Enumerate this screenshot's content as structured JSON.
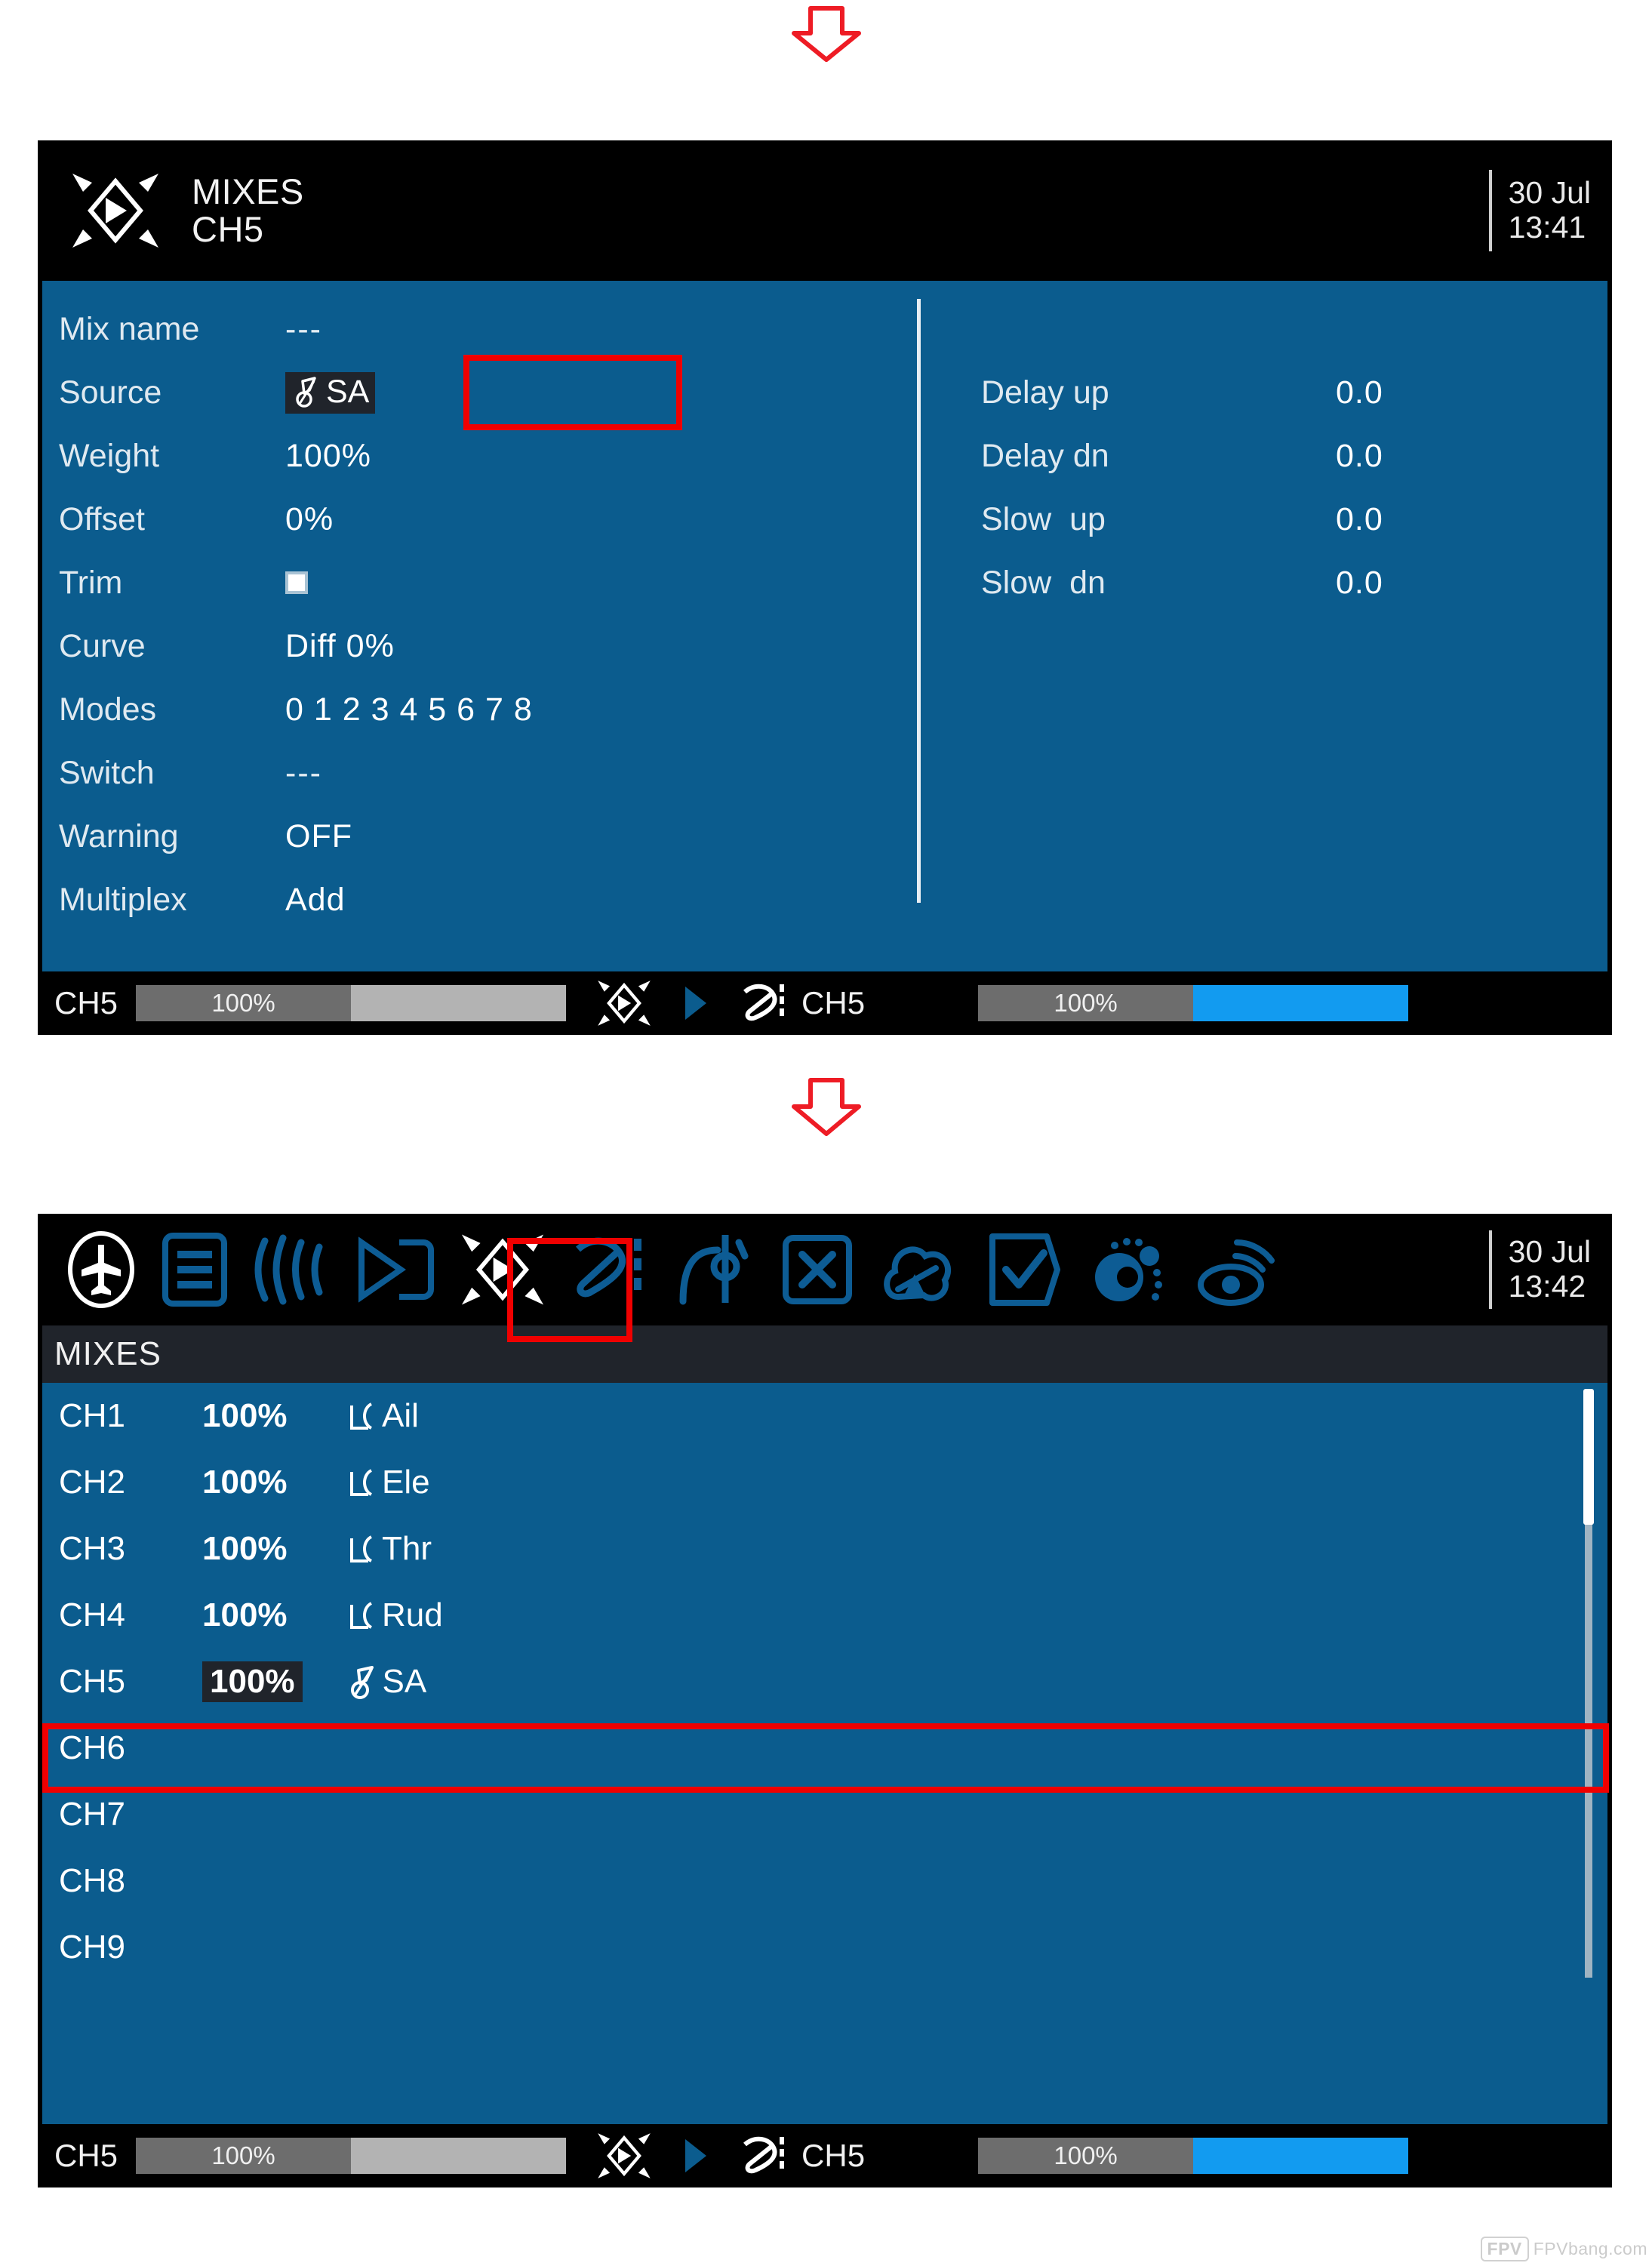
{
  "annotation": {
    "arrow_color": "#ee1c25",
    "watermark": "FPVbang.com",
    "watermark_badge": "FPV"
  },
  "mix_detail_screen": {
    "header": {
      "icon": "mixes-icon",
      "title": "MIXES",
      "subtitle": "CH5",
      "date": "30 Jul",
      "time": "13:41"
    },
    "left_fields": [
      {
        "label": "Mix name",
        "value": "---",
        "type": "dashes"
      },
      {
        "label": "Source",
        "value": "SA",
        "type": "switch-highlight"
      },
      {
        "label": "Weight",
        "value": "100%",
        "type": "text"
      },
      {
        "label": "Offset",
        "value": "0%",
        "type": "text"
      },
      {
        "label": "Trim",
        "value": "",
        "type": "checkbox"
      },
      {
        "label": "Curve",
        "value": "Diff  0%",
        "type": "text"
      },
      {
        "label": "Modes",
        "value": "0 1 2 3 4 5 6 7 8",
        "type": "text"
      },
      {
        "label": "Switch",
        "value": "---",
        "type": "dashes"
      },
      {
        "label": "Warning",
        "value": "OFF",
        "type": "text"
      },
      {
        "label": "Multiplex",
        "value": "Add",
        "type": "text"
      }
    ],
    "right_fields": [
      {
        "label": "Delay up",
        "value": "0.0"
      },
      {
        "label": "Delay dn",
        "value": "0.0"
      },
      {
        "label": "Slow  up",
        "value": "0.0"
      },
      {
        "label": "Slow  dn",
        "value": "0.0"
      }
    ],
    "status_bar": {
      "left_channel": "CH5",
      "left_percent": "100%",
      "left_fill_ratio": 0.5,
      "right_channel": "CH5",
      "right_percent": "100%",
      "right_fill_ratio": 0.5
    }
  },
  "mix_list_screen": {
    "header": {
      "date": "30 Jul",
      "time": "13:42",
      "icons": [
        "model-select-icon",
        "model-setup-icon",
        "heli-setup-icon",
        "flight-modes-icon",
        "mixes-icon",
        "outputs-icon",
        "curves-icon",
        "logical-switches-icon",
        "special-functions-icon",
        "custom-scripts-icon",
        "telemetry-icon",
        "display-icon"
      ]
    },
    "section_title": "MIXES",
    "rows": [
      {
        "channel": "CH1",
        "percent": "100%",
        "source": "Ail",
        "source_icon": "stick-icon",
        "selected": false
      },
      {
        "channel": "CH2",
        "percent": "100%",
        "source": "Ele",
        "source_icon": "stick-icon",
        "selected": false
      },
      {
        "channel": "CH3",
        "percent": "100%",
        "source": "Thr",
        "source_icon": "stick-icon",
        "selected": false
      },
      {
        "channel": "CH4",
        "percent": "100%",
        "source": "Rud",
        "source_icon": "stick-icon",
        "selected": false
      },
      {
        "channel": "CH5",
        "percent": "100%",
        "source": "SA",
        "source_icon": "switch-icon",
        "selected": true
      },
      {
        "channel": "CH6",
        "percent": "",
        "source": "",
        "source_icon": "",
        "selected": false
      },
      {
        "channel": "CH7",
        "percent": "",
        "source": "",
        "source_icon": "",
        "selected": false
      },
      {
        "channel": "CH8",
        "percent": "",
        "source": "",
        "source_icon": "",
        "selected": false
      },
      {
        "channel": "CH9",
        "percent": "",
        "source": "",
        "source_icon": "",
        "selected": false
      }
    ],
    "status_bar": {
      "left_channel": "CH5",
      "left_percent": "100%",
      "right_channel": "CH5",
      "right_percent": "100%"
    }
  }
}
